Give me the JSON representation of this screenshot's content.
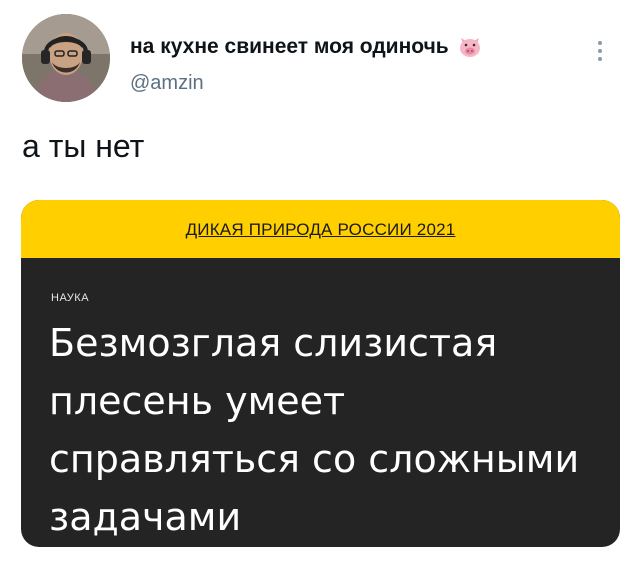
{
  "tweet": {
    "author": {
      "display_name": "на кухне свинеет моя одиночь",
      "emoji_icon": "pig-face-icon",
      "handle": "@amzin"
    },
    "more_icon": "more-options-icon",
    "text": "а ты нет"
  },
  "card": {
    "banner_link": "ДИКАЯ ПРИРОДА РОССИИ 2021",
    "category": "НАУКА",
    "headline": "Безмозглая слизистая плесень умеет справляться со сложными задачами"
  },
  "colors": {
    "banner": "#ffcf00",
    "card_background": "#242424",
    "handle_gray": "#5b7083"
  }
}
